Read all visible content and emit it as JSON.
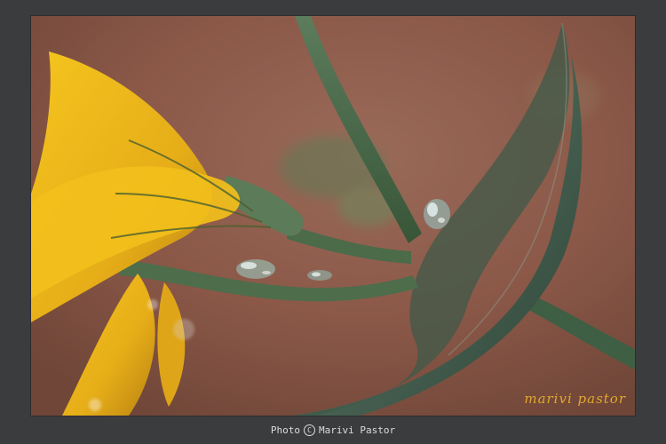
{
  "photo": {
    "subject": "flower-stem-with-water-droplets-icon",
    "signature": "marivi pastor"
  },
  "footer": {
    "credit_prefix": "Photo",
    "copyright_symbol": "C",
    "credit_author": "Marivi Pastor"
  },
  "colors": {
    "frame": "#3b3c3e",
    "background": "#8b5a4a",
    "petal": "#f0bd20",
    "leaf": "#4b6656",
    "stem": "#46684a",
    "signature": "#e1a72e"
  }
}
